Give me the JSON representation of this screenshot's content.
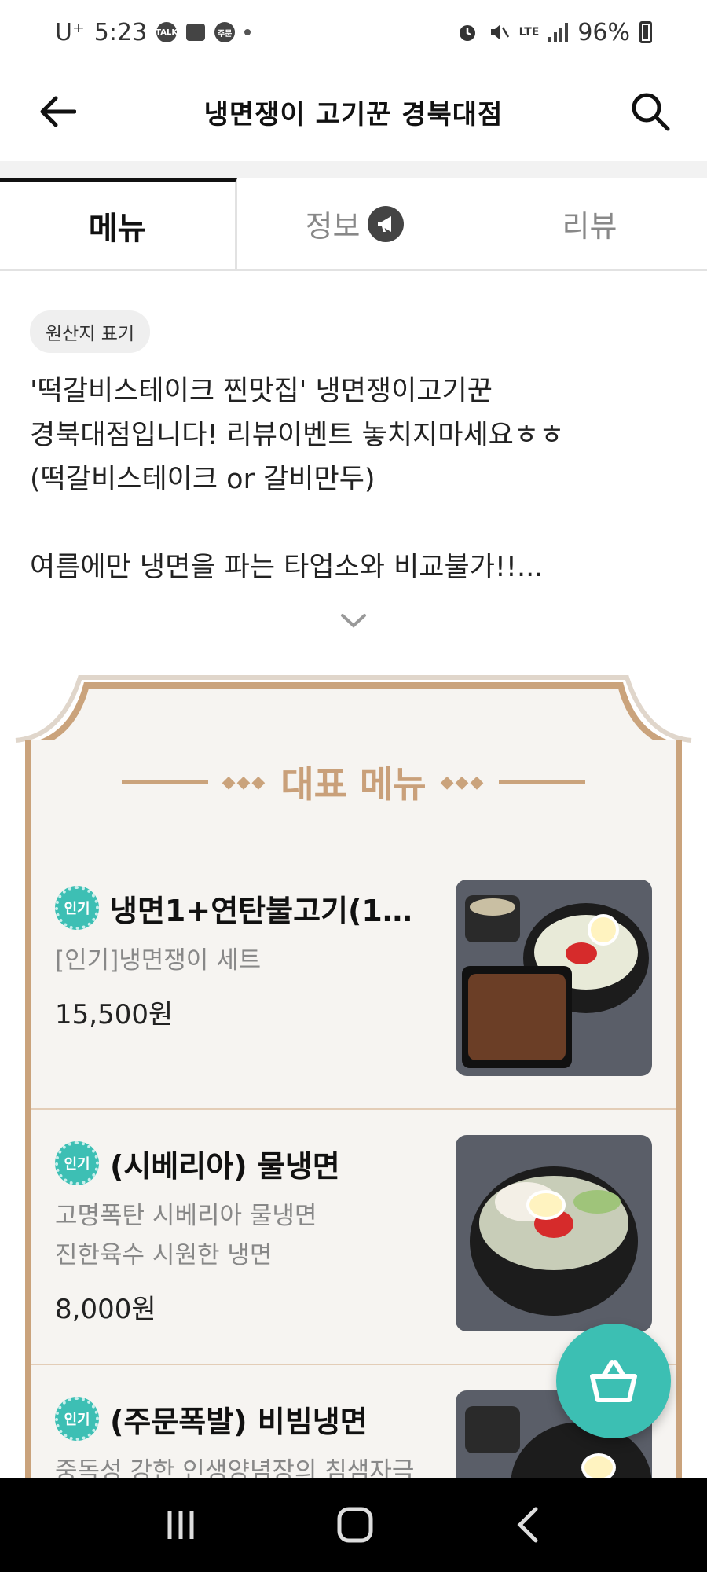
{
  "status_bar": {
    "carrier": "U⁺",
    "time": "5:23",
    "notif_icons": [
      "talk-icon",
      "gallery-icon",
      "order-icon"
    ],
    "notif_talk": "TALK",
    "notif_order": "주문",
    "battery": "96%",
    "network": "LTE"
  },
  "app_bar": {
    "title": "냉면쟁이 고기꾼 경북대점"
  },
  "tabs": [
    {
      "label": "메뉴",
      "active": true
    },
    {
      "label": "정보",
      "active": false,
      "icon": "megaphone-icon"
    },
    {
      "label": "리뷰",
      "active": false
    }
  ],
  "intro": {
    "origin_chip": "원산지 표기",
    "text": "'떡갈비스테이크 찐맛집' 냉면쟁이고기꾼\n경북대점입니다! 리뷰이벤트 놓치지마세요ㅎㅎ\n(떡갈비스테이크 or 갈비만두)\n\n여름에만 냉면을 파는 타업소와 비교불가!!..."
  },
  "featured": {
    "title": "대표 메뉴",
    "badge_label": "인기",
    "items": [
      {
        "name": "냉면1+연탄불고기(15...",
        "desc": "[인기]냉면쟁이 세트",
        "price": "15,500원"
      },
      {
        "name": "(시베리아) 물냉면",
        "desc": "고명폭탄 시베리아 물냉면\n진한육수 시원한 냉면",
        "price": "8,000원"
      },
      {
        "name": "(주문폭발) 비빔냉면",
        "desc": "중독성 강한 인생양념장의 침샘자극",
        "price": ""
      }
    ]
  },
  "colors": {
    "accent_teal": "#3cbfb3",
    "gold": "#caa37c"
  }
}
